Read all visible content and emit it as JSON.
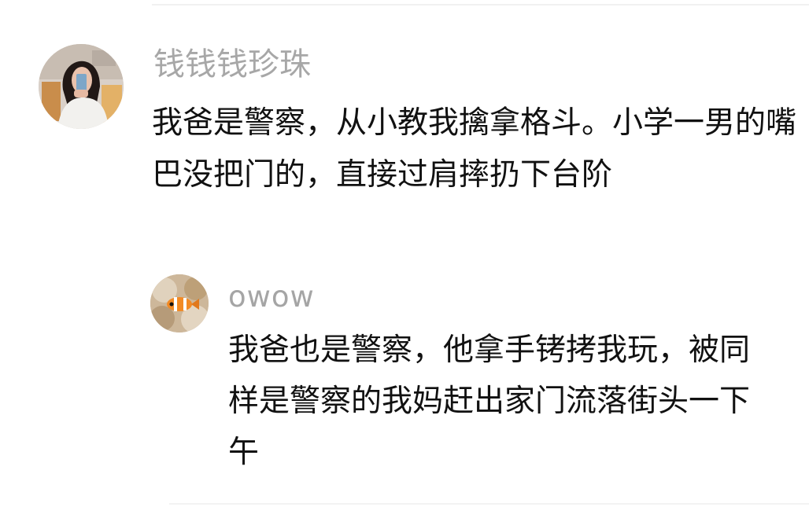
{
  "comments": [
    {
      "username": "钱钱钱珍珠",
      "text": "我爸是警察，从小教我擒拿格斗。小学一男的嘴巴没把门的，直接过肩摔扔下台阶",
      "avatar_icon": "user-photo-avatar-icon"
    }
  ],
  "replies": [
    {
      "username": "owow",
      "text": "我爸也是警察，他拿手铐拷我玩，被同样是警察的我妈赶出家门流落街头一下午",
      "avatar_icon": "clownfish-avatar-icon"
    }
  ],
  "colors": {
    "username_gray": "#a7a7a7",
    "text_black": "#111111",
    "background": "#ffffff"
  }
}
